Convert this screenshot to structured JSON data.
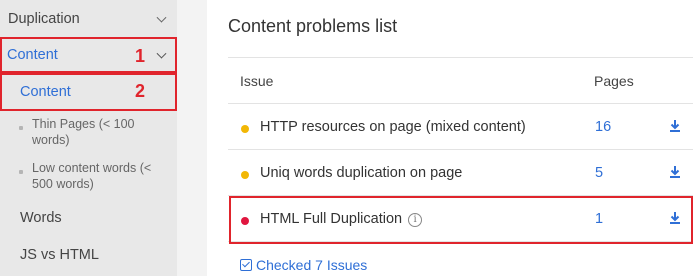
{
  "sidebar": {
    "duplication_label": "Duplication",
    "content_header_label": "Content",
    "content_sub_label": "Content",
    "thin_pages_label": "Thin Pages (< 100 words)",
    "low_content_label": "Low content words (< 500 words)",
    "words_label": "Words",
    "js_vs_html_label": "JS vs HTML"
  },
  "annotations": {
    "one": "1",
    "two": "2",
    "color": "#e0242c"
  },
  "main": {
    "title": "Content problems list",
    "columns": {
      "issue": "Issue",
      "pages": "Pages"
    },
    "rows": [
      {
        "issue": "HTTP resources on page (mixed content)",
        "pages": "16",
        "status_color": "#f2b705",
        "icon": "download-icon"
      },
      {
        "issue": "Uniq words duplication on page",
        "pages": "5",
        "status_color": "#f2b705",
        "icon": "download-icon"
      },
      {
        "issue": "HTML Full Duplication",
        "pages": "1",
        "status_color": "#e0163f",
        "icon": "download-icon",
        "info_icon": "info-icon"
      }
    ],
    "checked_label": "Checked 7 Issues"
  },
  "colors": {
    "accent": "#2f6fd6",
    "sidebar_bg": "#e8e8e8"
  }
}
